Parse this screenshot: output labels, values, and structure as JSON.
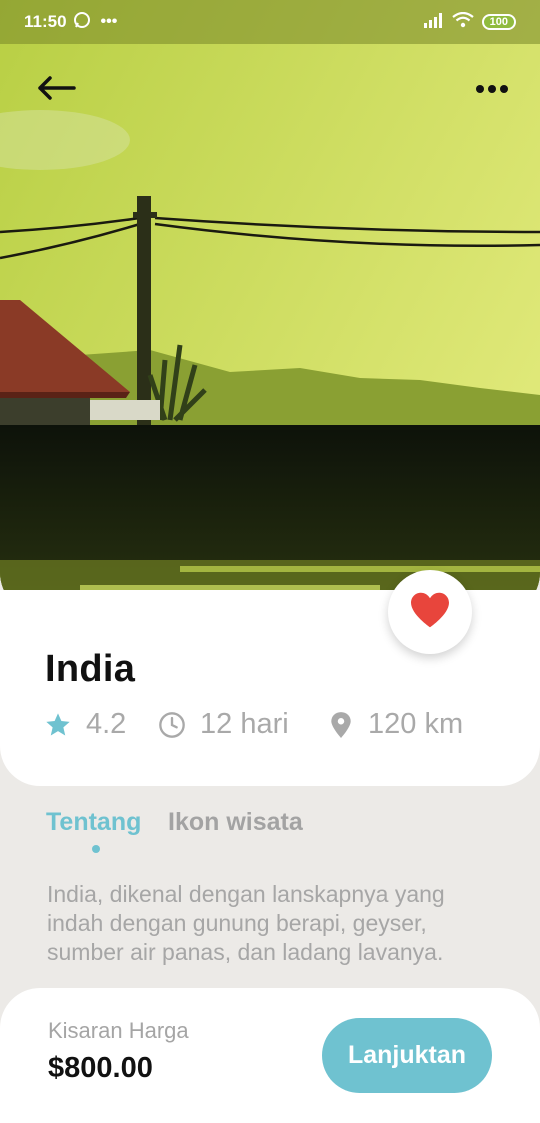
{
  "status_bar": {
    "time": "11:50",
    "battery": "100"
  },
  "hero": {
    "description": "Illustrated landscape of a village at dusk with a power pole, tiled roof and reflective water"
  },
  "place": {
    "title": "India",
    "rating": "4.2",
    "duration": "12 hari",
    "distance": "120 km"
  },
  "tabs": [
    {
      "label": "Tentang",
      "active": true
    },
    {
      "label": "Ikon wisata",
      "active": false
    }
  ],
  "description": "India, dikenal dengan lanskapnya yang indah dengan gunung berapi, geyser, sumber air panas, dan ladang lavanya.",
  "footer": {
    "price_label": "Kisaran Harga",
    "price": "$800.00",
    "cta_label": "Lanjuktan"
  },
  "colors": {
    "accent": "#6fc2d0",
    "heart": "#e8453c",
    "muted_text": "#a6a6a6",
    "background": "#eceae7"
  }
}
